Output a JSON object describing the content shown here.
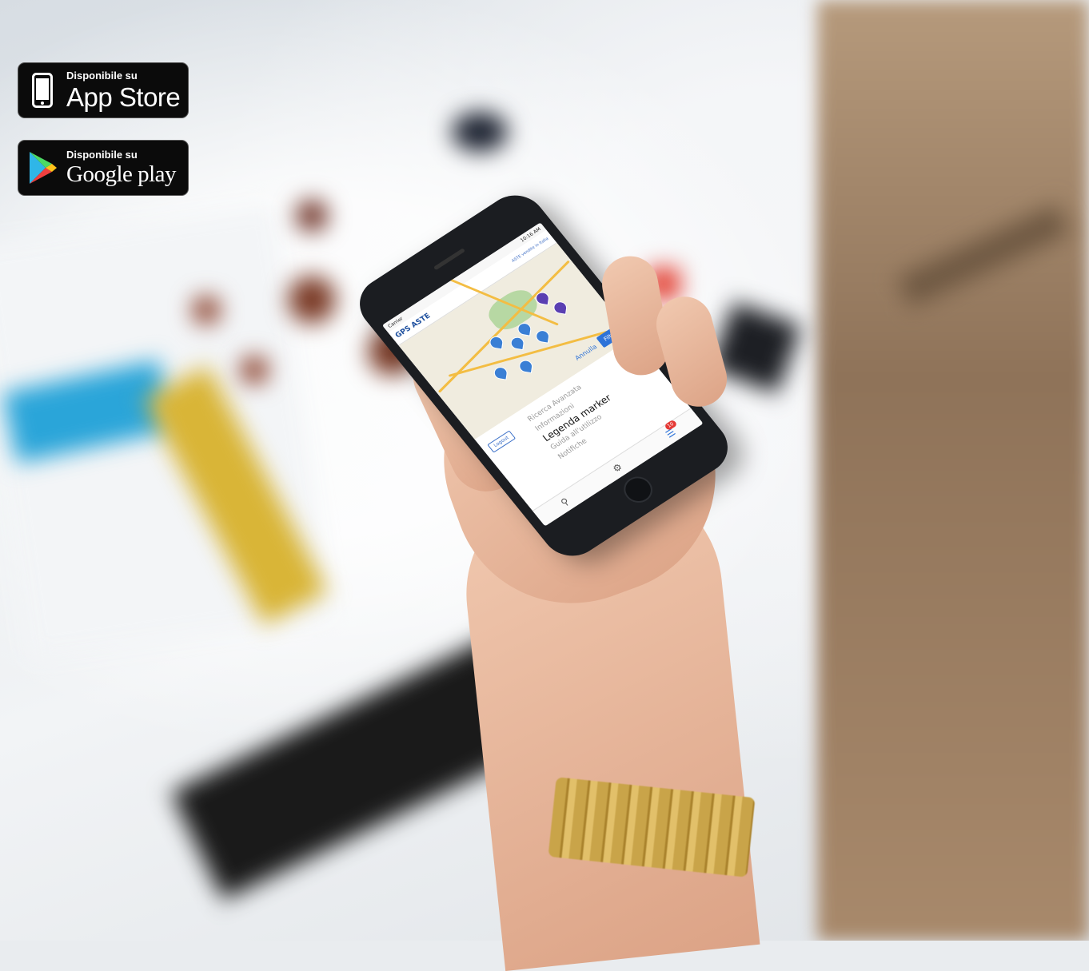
{
  "badges": {
    "appstore": {
      "small": "Disponibile su",
      "big": "App Store",
      "icon": "phone-icon"
    },
    "googleplay": {
      "small": "Disponibile su",
      "big": "Google play",
      "icon": "play-triangle-icon"
    }
  },
  "phone": {
    "status": {
      "carrier": "Carrier",
      "time": "10:16 AM"
    },
    "app_logo": "GPS ASTE",
    "app_tag": "ASTE vendite in Italia",
    "map_buttons": {
      "cancel": "Annulla",
      "primary": "Filtra"
    },
    "logout": "Logout",
    "menu": {
      "items": [
        "Ricerca Avanzata",
        "Informazioni",
        "Legenda marker",
        "Guida all'utilizzo",
        "Notifiche"
      ],
      "selected_index": 2
    },
    "tabbar": {
      "search_icon": "search-icon",
      "joystick_icon": "joystick-icon",
      "list_icon": "list-icon",
      "notification_count": "10"
    }
  },
  "colors": {
    "accent": "#2e73d8",
    "badge_bg": "#0b0b0b",
    "pin": "#3a7fd5",
    "pin_purple": "#5a3fb2",
    "notif": "#e53935"
  }
}
